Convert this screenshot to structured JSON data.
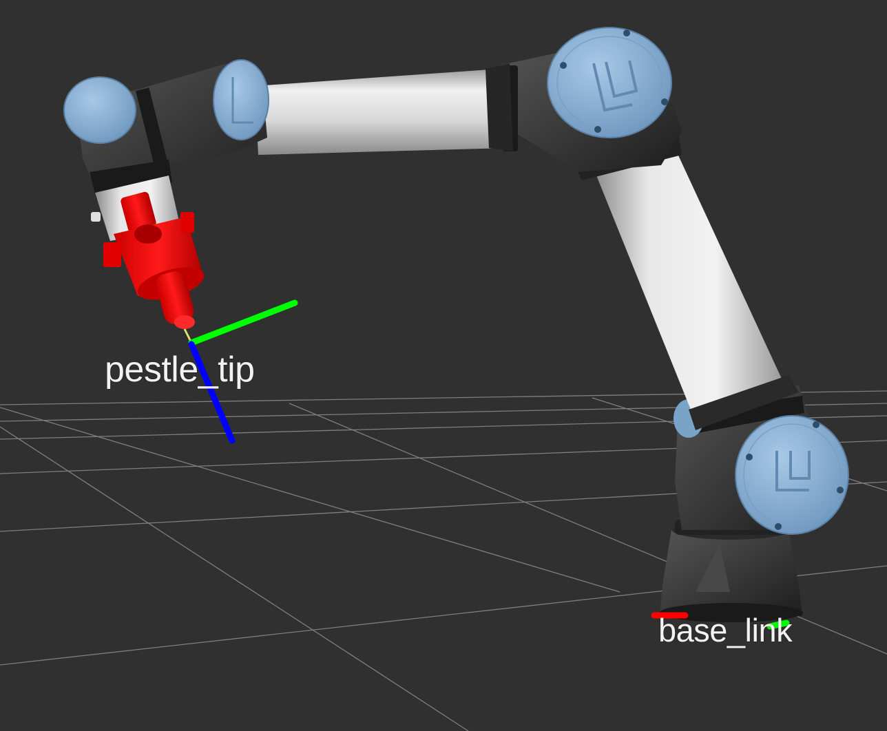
{
  "viewer": {
    "background_color": "#303030",
    "grid_color": "#a0a0a0"
  },
  "frames": [
    {
      "id": "pestle_tip",
      "label": "pestle_tip"
    },
    {
      "id": "base_link",
      "label": "base_link"
    }
  ],
  "axis_colors": {
    "x": "#ff0000",
    "y": "#00ff00",
    "z": "#0000ff"
  },
  "robot": {
    "joint_cap_color": "#8ab4dc",
    "link_color": "#e6e6e6",
    "joint_body_color": "#3a3a3a",
    "end_effector_color": "#ff0000"
  }
}
